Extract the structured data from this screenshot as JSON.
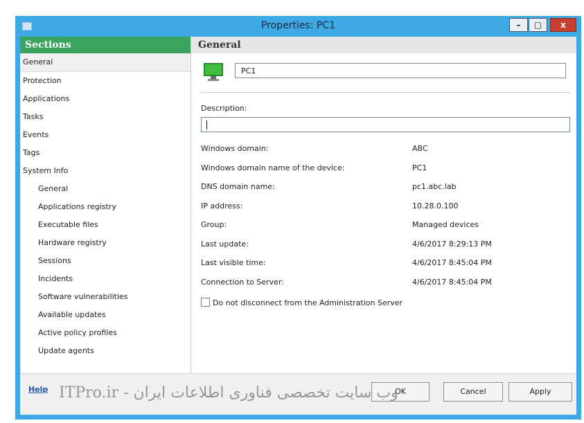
{
  "window": {
    "title": "Properties: PC1",
    "min_glyph": "–",
    "max_glyph": "▢",
    "close_glyph": "x"
  },
  "sections": {
    "header": "Sections",
    "items": [
      {
        "label": "General",
        "selected": true
      },
      {
        "label": "Protection"
      },
      {
        "label": "Applications"
      },
      {
        "label": "Tasks"
      },
      {
        "label": "Events"
      },
      {
        "label": "Tags"
      },
      {
        "label": "System Info"
      },
      {
        "label": "General",
        "sub": true
      },
      {
        "label": "Applications registry",
        "sub": true
      },
      {
        "label": "Executable files",
        "sub": true
      },
      {
        "label": "Hardware registry",
        "sub": true
      },
      {
        "label": "Sessions",
        "sub": true
      },
      {
        "label": "Incidents",
        "sub": true
      },
      {
        "label": "Software vulnerabilities",
        "sub": true
      },
      {
        "label": "Available updates",
        "sub": true
      },
      {
        "label": "Active policy profiles",
        "sub": true
      },
      {
        "label": "Update agents",
        "sub": true
      }
    ]
  },
  "general": {
    "header": "General",
    "name_value": "PC1",
    "description_label": "Description:",
    "description_value": "",
    "properties": [
      {
        "label": "Windows domain:",
        "value": "ABC"
      },
      {
        "label": "Windows domain name of the device:",
        "value": "PC1"
      },
      {
        "label": "DNS domain name:",
        "value": "pc1.abc.lab"
      },
      {
        "label": "IP address:",
        "value": "10.28.0.100"
      },
      {
        "label": "Group:",
        "value": "Managed devices"
      },
      {
        "label": "Last update:",
        "value": "4/6/2017 8:29:13 PM"
      },
      {
        "label": "Last visible time:",
        "value": "4/6/2017 8:45:04 PM"
      },
      {
        "label": "Connection to Server:",
        "value": "4/6/2017 8:45:04 PM"
      }
    ],
    "checkbox_label": "Do not disconnect from the Administration Server",
    "checkbox_checked": false
  },
  "footer": {
    "help": "Help",
    "ok": "OK",
    "cancel": "Cancel",
    "apply": "Apply"
  },
  "watermark": "وب سایت تخصصی فناوری اطلاعات ایران - ITPro.ir",
  "colors": {
    "title_bar": "#3fa9e6",
    "sections_header": "#3aa35e",
    "close_button": "#c7402f",
    "monitor_screen": "#3fbf3f"
  }
}
